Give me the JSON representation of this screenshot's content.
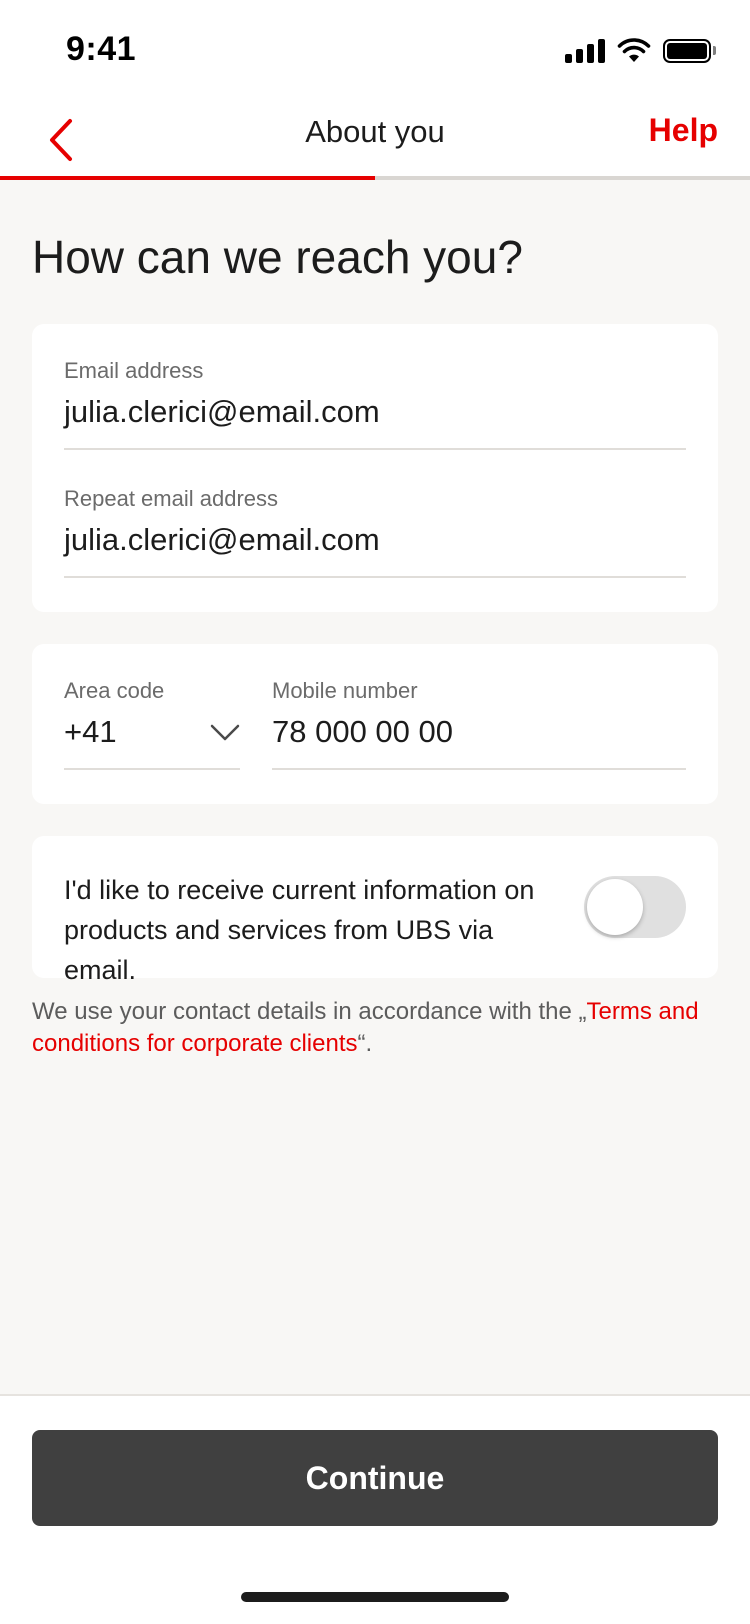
{
  "status_bar": {
    "time": "9:41"
  },
  "header": {
    "title": "About you",
    "help_label": "Help",
    "progress_fraction": 0.5
  },
  "page": {
    "title": "How can we reach you?"
  },
  "email_card": {
    "email": {
      "label": "Email address",
      "value": "julia.clerici@email.com"
    },
    "repeat_email": {
      "label": "Repeat email address",
      "value": "julia.clerici@email.com"
    }
  },
  "phone_card": {
    "area_code": {
      "label": "Area code",
      "value": "+41"
    },
    "mobile": {
      "label": "Mobile number",
      "value": "78 000 00 00"
    }
  },
  "newsletter": {
    "text": "I'd like to receive current information on products and services from UBS via email.",
    "enabled": false
  },
  "legal": {
    "prefix": "We use your contact details in accordance with the „",
    "link": "Terms and conditions for corporate clients",
    "suffix": "“."
  },
  "footer": {
    "continue_label": "Continue"
  },
  "colors": {
    "accent": "#e60000",
    "button": "#404040",
    "background": "#f8f7f5"
  },
  "icons": {
    "back": "chevron-left-icon",
    "dropdown": "chevron-down-icon",
    "signal": "cellular-signal-icon",
    "wifi": "wifi-icon",
    "battery": "battery-icon"
  }
}
